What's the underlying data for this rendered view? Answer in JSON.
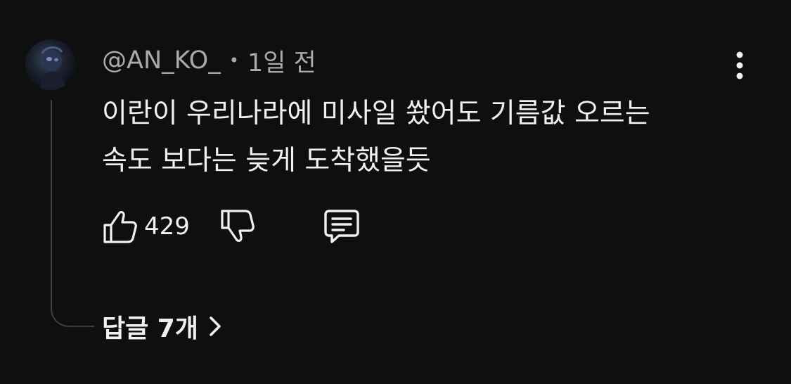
{
  "comment": {
    "author": "@AN_KO_",
    "separator": "•",
    "time": "1일 전",
    "line1": "이란이 우리나라에 미사일 쐈어도 기름값 오르는",
    "line2": "속도 보다는 늦게 도착했을듯",
    "like_count": "429",
    "replies_label": "답글 7개"
  },
  "icons": {
    "like": "thumbs-up-icon",
    "dislike": "thumbs-down-icon",
    "reply": "comment-bubble-icon",
    "more": "more-vertical-icon",
    "replies_chevron": "chevron-right-icon"
  },
  "colors": {
    "background": "#0f0f0f",
    "primary_text": "#f1f1f1",
    "secondary_text": "#aaaaaa",
    "thread_line": "#3f3f3f"
  }
}
